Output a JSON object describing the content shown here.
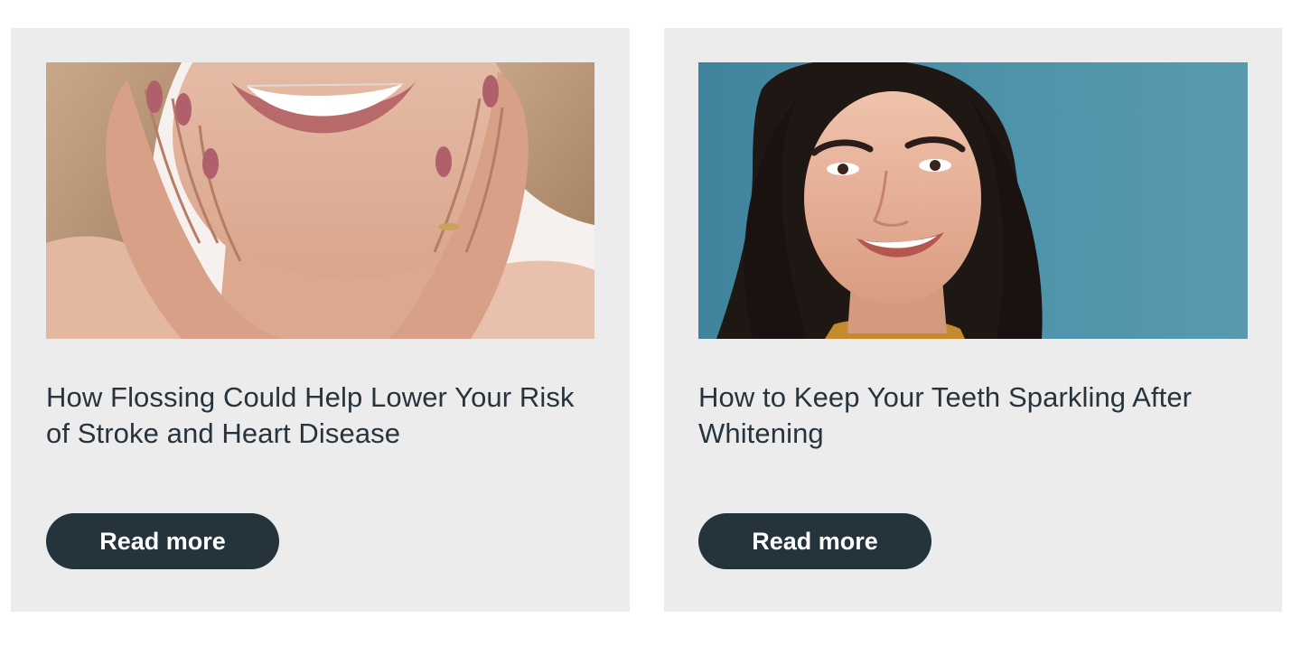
{
  "articles": [
    {
      "title": "How Flossing Could Help Lower Your Risk of Stroke and Heart Disease",
      "button_label": "Read more",
      "image_icon": "smiling-older-woman-photo"
    },
    {
      "title": "How to Keep Your Teeth Sparkling After Whitening",
      "button_label": "Read more",
      "image_icon": "smiling-young-woman-photo"
    }
  ],
  "colors": {
    "card_background": "#ececec",
    "title_text": "#27343d",
    "button_background": "#24333c",
    "button_text": "#ffffff",
    "photo2_background": "#4f92a8"
  }
}
